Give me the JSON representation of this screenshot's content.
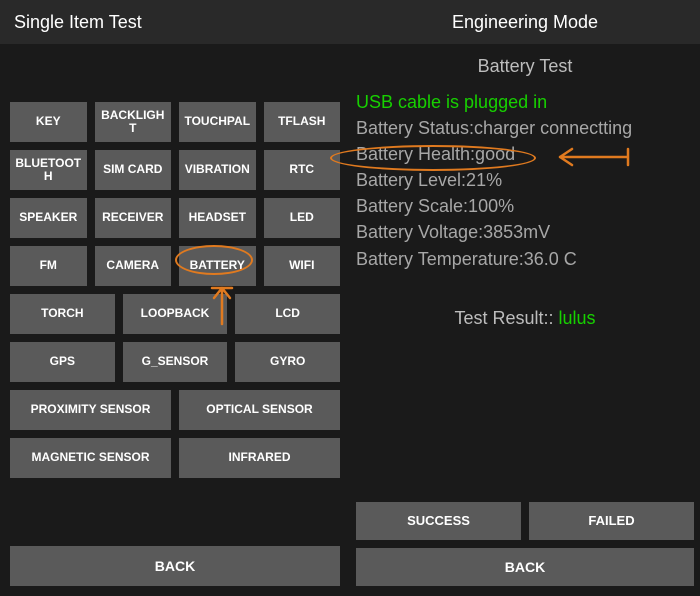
{
  "left": {
    "title": "Single Item Test",
    "rows4": [
      [
        "KEY",
        "BACKLIGHT",
        "TOUCHPAL",
        "TFLASH"
      ],
      [
        "BLUETOOTH",
        "SIM CARD",
        "VIBRATION",
        "RTC"
      ],
      [
        "SPEAKER",
        "RECEIVER",
        "HEADSET",
        "LED"
      ],
      [
        "FM",
        "CAMERA",
        "BATTERY",
        "WIFI"
      ]
    ],
    "rows3": [
      [
        "TORCH",
        "LOOPBACK",
        "LCD"
      ],
      [
        "GPS",
        "G_SENSOR",
        "GYRO"
      ]
    ],
    "rows2": [
      [
        "PROXIMITY SENSOR",
        "OPTICAL SENSOR"
      ],
      [
        "MAGNETIC SENSOR",
        "INFRARED"
      ]
    ],
    "back": "BACK"
  },
  "right": {
    "title": "Engineering Mode",
    "subtitle": "Battery Test",
    "usb_line": "USB cable is plugged in",
    "status": "Battery Status:charger connectting",
    "health": "Battery Health:good",
    "level": "Battery Level:21%",
    "scale": "Battery Scale:100%",
    "voltage": "Battery Voltage:3853mV",
    "temperature": "Battery Temperature:36.0 C",
    "result_label": "Test Result:: ",
    "result_value": "lulus",
    "success": "SUCCESS",
    "failed": "FAILED",
    "back": "BACK"
  },
  "annotations": {
    "highlight_button": "BATTERY",
    "highlight_info": "Battery Health:good",
    "color": "#e07a1f"
  }
}
